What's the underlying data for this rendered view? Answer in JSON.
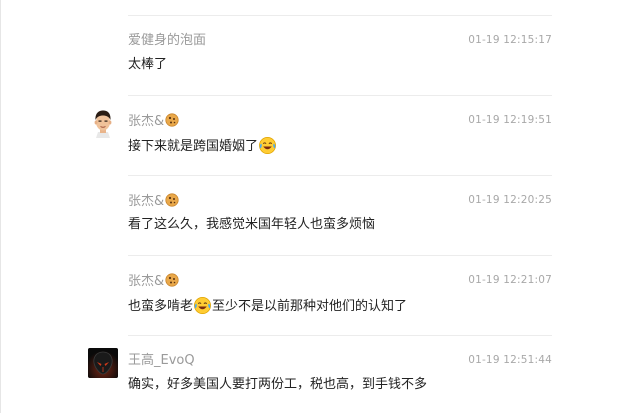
{
  "comments": [
    {
      "username": "爱健身的泡面",
      "has_cookie": false,
      "timestamp": "01-19 12:15:17",
      "text_before": "太棒了",
      "emoji": "",
      "text_after": "",
      "avatar": ""
    },
    {
      "username": "张杰&",
      "has_cookie": true,
      "timestamp": "01-19 12:19:51",
      "text_before": "接下来就是跨国婚姻了",
      "emoji": "laughing-tears-emoji",
      "text_after": "",
      "avatar": "cartoon-man-avatar"
    },
    {
      "username": "张杰&",
      "has_cookie": true,
      "timestamp": "01-19 12:20:25",
      "text_before": "看了这么久，我感觉米国年轻人也蛮多烦恼",
      "emoji": "",
      "text_after": "",
      "avatar": ""
    },
    {
      "username": "张杰&",
      "has_cookie": true,
      "timestamp": "01-19 12:21:07",
      "text_before": "也蛮多啃老",
      "emoji": "laughing-tears-emoji",
      "text_after": "至少不是以前那种对他们的认知了",
      "avatar": ""
    },
    {
      "username": "王高_EvoQ",
      "has_cookie": false,
      "timestamp": "01-19 12:51:44",
      "text_before": "确实，好多美国人要打两份工，税也高，到手钱不多",
      "emoji": "",
      "text_after": "",
      "avatar": "dark-alien-avatar"
    }
  ],
  "colors": {
    "username": "#9a9a9a",
    "timestamp": "#a8a8a8",
    "text": "#222222",
    "divider": "#ececec"
  }
}
